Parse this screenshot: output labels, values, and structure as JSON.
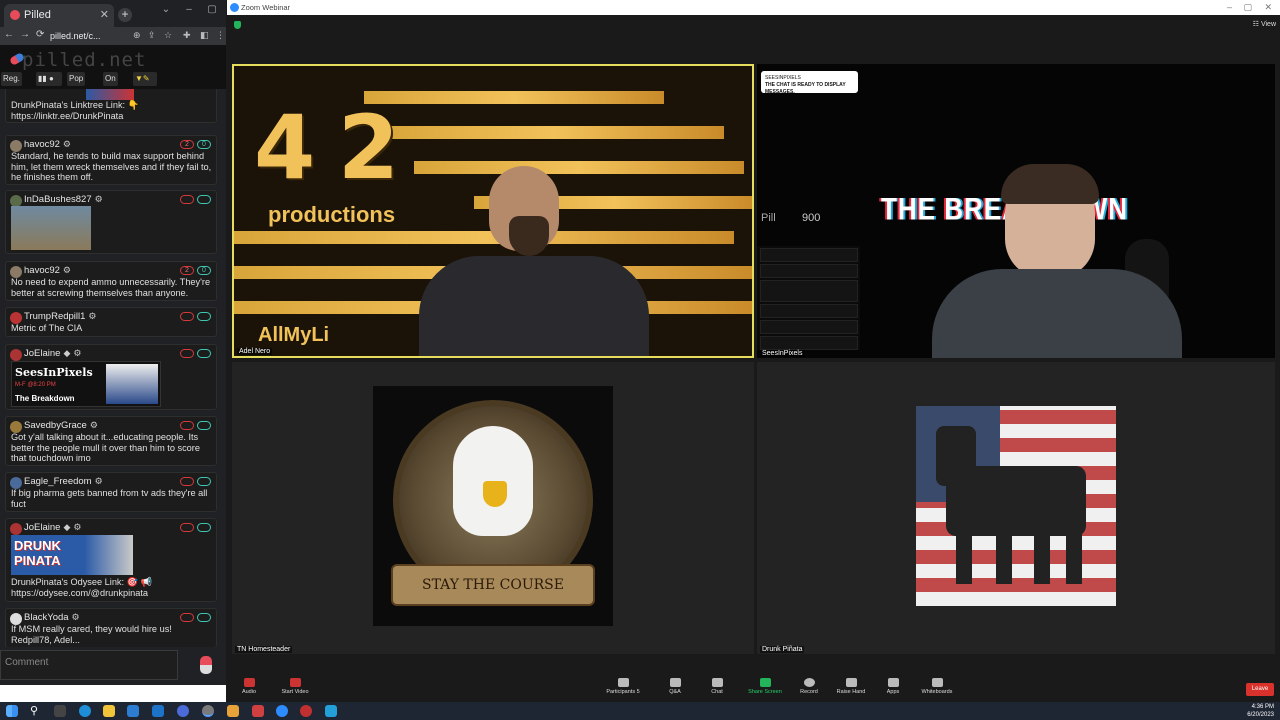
{
  "browser": {
    "tab_title": "Pilled",
    "url": "pilled.net/c...",
    "site_logo": "pilled.net",
    "header_buttons": [
      "Reg.",
      "Pop",
      "On"
    ]
  },
  "chat": {
    "messages": [
      {
        "name": "",
        "text": "DrunkPinata's Linktree Link: 👇 https://linktr.ee/DrunkPinata"
      },
      {
        "name": "havoc92",
        "badge_count": "2",
        "badge_green": "0",
        "text": "Standard, he tends to build max support behind him, let them wreck themselves and if they fail to, he finishes them off."
      },
      {
        "name": "InDaBushes827",
        "text": ""
      },
      {
        "name": "havoc92",
        "badge_count": "2",
        "badge_green": "0",
        "text": "No need to expend ammo unnecessarily. They're better at screwing themselves than anyone."
      },
      {
        "name": "TrumpRedpill1",
        "text": "Metric of The CIA"
      },
      {
        "name": "JoElaine",
        "text": "",
        "card_title": "SeesInPixels",
        "card_sub": "M-F @8:20 PM",
        "card_show": "The Breakdown"
      },
      {
        "name": "SavedbyGrace",
        "text": "Got y'all talking about it...educating people. Its better the people mull it over than him to score that touchdown imo"
      },
      {
        "name": "Eagle_Freedom",
        "text": "If big pharma gets banned from tv ads they're all fuct"
      },
      {
        "name": "JoElaine",
        "text": "DrunkPinata's Odysee Link: 🎯 📢 https://odysee.com/@drunkpinata",
        "card_title": "DRUNK PINATA"
      },
      {
        "name": "BlackYoda",
        "text": "If MSM really cared, they would hire us! Redpill78, Adel..."
      }
    ],
    "comment_placeholder": "Comment"
  },
  "zoom": {
    "window_title": "Zoom Webinar",
    "view_label": "View",
    "tiles": {
      "adel": {
        "name": "Adel Nero",
        "brand_number": "4 2",
        "brand_word": "productions",
        "brand_tag": "AllMyLi"
      },
      "sees": {
        "name": "SeesInPixels",
        "bubble_title": "SEESINPIXELS",
        "bubble_text": "THE CHAT IS READY TO DISPLAY MESSAGES.",
        "overlay_title": "THE BREAKDOWN",
        "pill_label": "Pill",
        "pill_count": "900"
      },
      "tn": {
        "name": "TN Homesteader",
        "banner": "STAY THE COURSE"
      },
      "drunk": {
        "name": "Drunk Piñata"
      }
    },
    "toolbar": {
      "audio": "Audio",
      "video": "Start Video",
      "participants": "Participants",
      "participants_count": "5",
      "qa": "Q&A",
      "chat": "Chat",
      "share": "Share Screen",
      "record": "Record",
      "raise": "Raise Hand",
      "apps": "Apps",
      "whiteboards": "Whiteboards",
      "leave": "Leave"
    }
  },
  "taskbar": {
    "time": "4:36 PM",
    "date": "6/20/2023"
  }
}
